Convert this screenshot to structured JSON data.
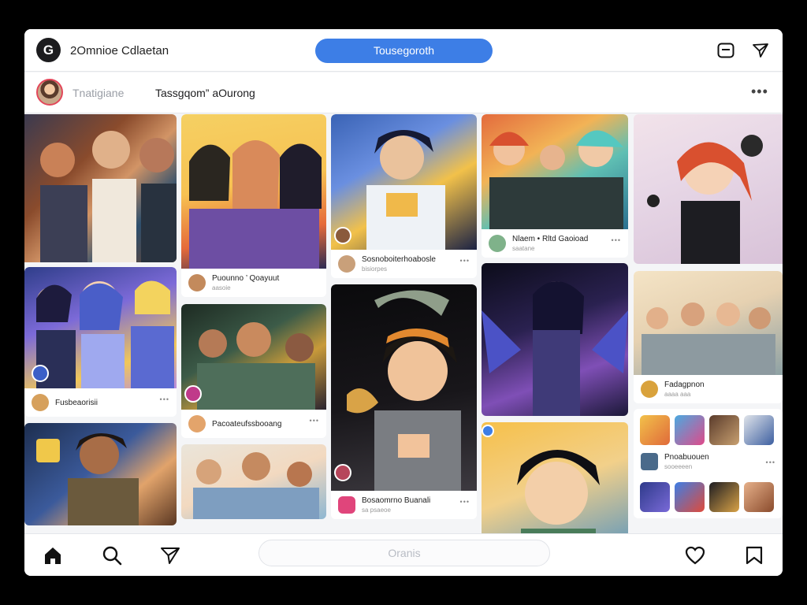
{
  "header": {
    "logo_glyph": "G",
    "title": "2Omnioe Cdlaetan",
    "search_label": "Tousegoroth"
  },
  "profile": {
    "username": "Tnatigiane",
    "post_title": "Tassgqom” aOurong"
  },
  "colors": {
    "accent": "#3d7ee6",
    "badge_red": "#e2475a",
    "heart_pink": "#e0457b"
  },
  "icons": {
    "inbox": "inbox-icon",
    "send": "paper-plane-icon",
    "home": "home-icon",
    "search": "search-icon",
    "like": "heart-icon",
    "save": "bookmark-icon"
  },
  "feed": {
    "captions": [
      {
        "title": "Fusbeaorisii",
        "sub": "•••"
      },
      {
        "title": "Puounno ’ Qoayuut",
        "sub": "aasoie"
      },
      {
        "title": "Pacoateufssbooang",
        "sub": "•••"
      },
      {
        "title": "Sosnoboiterhoabosle",
        "sub": "bisiorpes"
      },
      {
        "title": "Bosaomrno Buanali",
        "sub": "sa psaeoe"
      },
      {
        "title": "Nlaem • Rltd Gaoioad",
        "sub": "saatane"
      },
      {
        "title": "Fadagpnon",
        "sub": "aaaa aaa"
      },
      {
        "title": "Pnoabuouen",
        "sub": "sooeeeen"
      }
    ]
  },
  "bottom": {
    "message_placeholder": "Oranis"
  }
}
